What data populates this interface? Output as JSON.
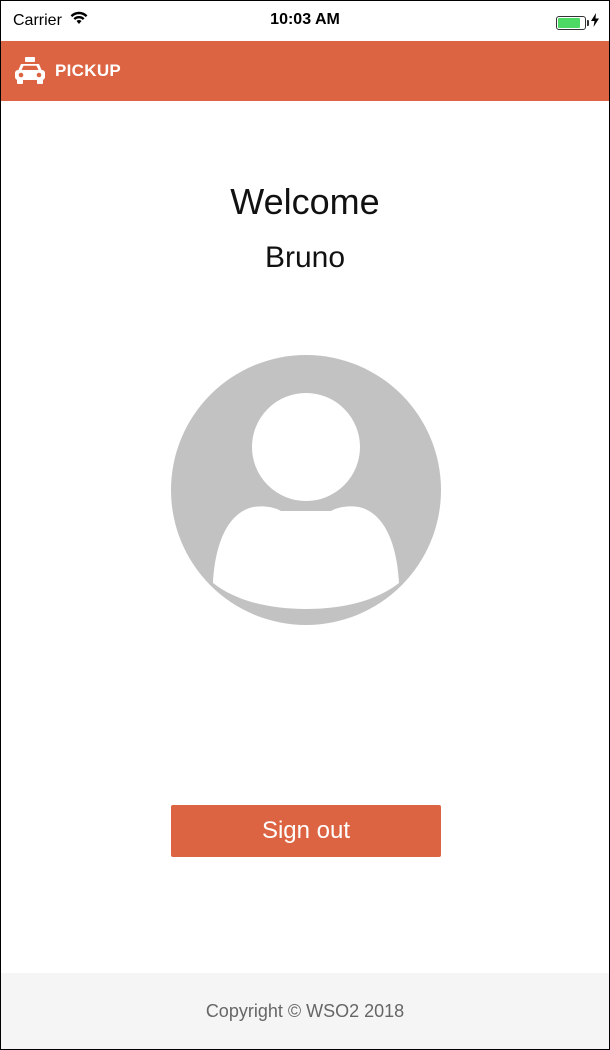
{
  "status_bar": {
    "carrier": "Carrier",
    "time": "10:03 AM",
    "icons": [
      "wifi-icon",
      "battery-icon",
      "charging-bolt-icon"
    ],
    "battery_level": 0.85,
    "battery_color": "#4cd964"
  },
  "app_bar": {
    "title": "PICKUP",
    "icon": "taxi-icon",
    "background": "#dc6442"
  },
  "main": {
    "welcome_title": "Welcome",
    "user_name": "Bruno",
    "avatar_icon": "user-avatar-icon",
    "avatar_color": "#c2c2c2"
  },
  "actions": {
    "sign_out_label": "Sign out",
    "button_color": "#dc6442"
  },
  "footer": {
    "copyright": "Copyright ©  WSO2 2018"
  }
}
